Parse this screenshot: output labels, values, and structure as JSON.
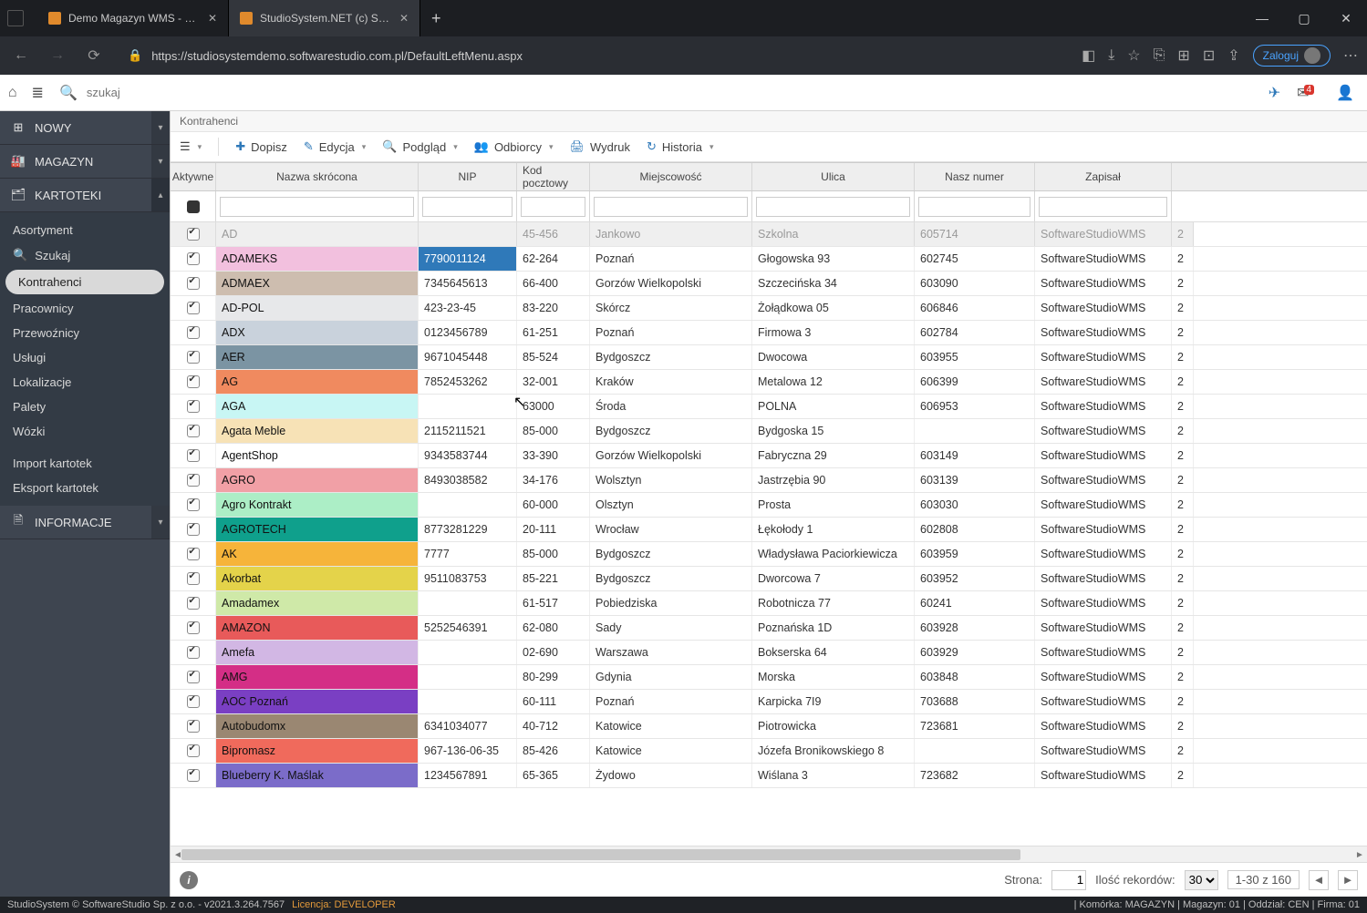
{
  "browser": {
    "tabs": [
      {
        "label": "Demo Magazyn WMS - Demo o…"
      },
      {
        "label": "StudioSystem.NET (c) SoftwareSt…"
      }
    ],
    "url": "https://studiosystemdemo.softwarestudio.com.pl/DefaultLeftMenu.aspx",
    "login": "Zaloguj"
  },
  "apptop": {
    "search_placeholder": "szukaj",
    "mail_badge": "4"
  },
  "sidebar": {
    "sections": {
      "nowy": "NOWY",
      "magazyn": "MAGAZYN",
      "kartoteki": "KARTOTEKI",
      "informacje": "INFORMACJE"
    },
    "kartoteki_sub": {
      "asortyment": "Asortyment",
      "szukaj": "Szukaj",
      "kontrahenci": "Kontrahenci",
      "pracownicy": "Pracownicy",
      "przewoznicy": "Przewoźnicy",
      "uslugi": "Usługi",
      "lokalizacje": "Lokalizacje",
      "palety": "Palety",
      "wozki": "Wózki",
      "import": "Import kartotek",
      "eksport": "Eksport kartotek"
    }
  },
  "crumb": "Kontrahenci",
  "toolbar": {
    "dopisz": "Dopisz",
    "edycja": "Edycja",
    "podglad": "Podgląd",
    "odbiorcy": "Odbiorcy",
    "wydruk": "Wydruk",
    "historia": "Historia"
  },
  "columns": {
    "aktywne": "Aktywne",
    "nazwa": "Nazwa skrócona",
    "nip": "NIP",
    "kod": "Kod pocztowy",
    "miejsc": "Miejscowość",
    "ulica": "Ulica",
    "naszn": "Nasz numer",
    "zapis": "Zapisał"
  },
  "rows": [
    {
      "partial": true,
      "chk": true,
      "name": "AD",
      "nip": "",
      "zip": "45-456",
      "city": "Jankowo",
      "street": "Szkolna",
      "num": "605714",
      "user": "SoftwareStudioWMS",
      "rest": "2",
      "bg": ""
    },
    {
      "chk": true,
      "name": "ADAMEKS",
      "nip": "7790011124",
      "zip": "62-264",
      "city": "Poznań",
      "street": "Głogowska 93",
      "num": "602745",
      "user": "SoftwareStudioWMS",
      "rest": "2",
      "bg": "#f2c0de",
      "sel": true
    },
    {
      "chk": true,
      "name": "ADMAEX",
      "nip": "7345645613",
      "zip": "66-400",
      "city": "Gorzów Wielkopolski",
      "street": "Szczecińska 34",
      "num": "603090",
      "user": "SoftwareStudioWMS",
      "rest": "2",
      "bg": "#cdbdaf"
    },
    {
      "chk": true,
      "name": "AD-POL",
      "nip": "423-23-45",
      "zip": "83-220",
      "city": "Skórcz",
      "street": "Żołądkowa 05",
      "num": "606846",
      "user": "SoftwareStudioWMS",
      "rest": "2",
      "bg": "#e7e8ea"
    },
    {
      "chk": true,
      "name": "ADX",
      "nip": "0123456789",
      "zip": "61-251",
      "city": "Poznań",
      "street": "Firmowa 3",
      "num": "602784",
      "user": "SoftwareStudioWMS",
      "rest": "2",
      "bg": "#c9d2dc"
    },
    {
      "chk": true,
      "name": "AER",
      "nip": "9671045448",
      "zip": "85-524",
      "city": "Bydgoszcz",
      "street": "Dwocowa",
      "num": "603955",
      "user": "SoftwareStudioWMS",
      "rest": "2",
      "bg": "#7b94a3"
    },
    {
      "chk": true,
      "name": "AG",
      "nip": "7852453262",
      "zip": "32-001",
      "city": "Kraków",
      "street": "Metalowa 12",
      "num": "606399",
      "user": "SoftwareStudioWMS",
      "rest": "2",
      "bg": "#f08a5f"
    },
    {
      "chk": true,
      "name": "AGA",
      "nip": "",
      "zip": "63000",
      "city": "Środa",
      "street": "POLNA",
      "num": "606953",
      "user": "SoftwareStudioWMS",
      "rest": "2",
      "bg": "#c8f6f4"
    },
    {
      "chk": true,
      "name": "Agata Meble",
      "nip": "2115211521",
      "zip": "85-000",
      "city": "Bydgoszcz",
      "street": "Bydgoska 15",
      "num": "",
      "user": "SoftwareStudioWMS",
      "rest": "2",
      "bg": "#f7e2b6"
    },
    {
      "chk": true,
      "name": "AgentShop",
      "nip": "9343583744",
      "zip": "33-390",
      "city": "Gorzów Wielkopolski",
      "street": "Fabryczna 29",
      "num": "603149",
      "user": "SoftwareStudioWMS",
      "rest": "2",
      "bg": "#ffffff"
    },
    {
      "chk": true,
      "name": "AGRO",
      "nip": "8493038582",
      "zip": "34-176",
      "city": "Wolsztyn",
      "street": "Jastrzębia 90",
      "num": "603139",
      "user": "SoftwareStudioWMS",
      "rest": "2",
      "bg": "#f1a0a6"
    },
    {
      "chk": true,
      "name": "Agro Kontrakt",
      "nip": "",
      "zip": "60-000",
      "city": "Olsztyn",
      "street": "Prosta",
      "num": "603030",
      "user": "SoftwareStudioWMS",
      "rest": "2",
      "bg": "#aceec6"
    },
    {
      "chk": true,
      "name": "AGROTECH",
      "nip": "8773281229",
      "zip": "20-111",
      "city": "Wrocław",
      "street": "Łękołody 1",
      "num": "602808",
      "user": "SoftwareStudioWMS",
      "rest": "2",
      "bg": "#0fa08c"
    },
    {
      "chk": true,
      "name": "AK",
      "nip": "7777",
      "zip": "85-000",
      "city": "Bydgoszcz",
      "street": "Władysława Paciorkiewicza",
      "num": "603959",
      "user": "SoftwareStudioWMS",
      "rest": "2",
      "bg": "#f6b43a"
    },
    {
      "chk": true,
      "name": "Akorbat",
      "nip": "9511083753",
      "zip": "85-221",
      "city": "Bydgoszcz",
      "street": "Dworcowa 7",
      "num": "603952",
      "user": "SoftwareStudioWMS",
      "rest": "2",
      "bg": "#e4d34a"
    },
    {
      "chk": true,
      "name": "Amadamex",
      "nip": "",
      "zip": "61-517",
      "city": "Pobiedziska",
      "street": "Robotnicza 77",
      "num": "60241",
      "user": "SoftwareStudioWMS",
      "rest": "2",
      "bg": "#cfe9a8"
    },
    {
      "chk": true,
      "name": "AMAZON",
      "nip": "5252546391",
      "zip": "62-080",
      "city": "Sady",
      "street": "Poznańska 1D",
      "num": "603928",
      "user": "SoftwareStudioWMS",
      "rest": "2",
      "bg": "#e85a5a"
    },
    {
      "chk": true,
      "name": "Amefa",
      "nip": "",
      "zip": "02-690",
      "city": "Warszawa",
      "street": "Bokserska 64",
      "num": "603929",
      "user": "SoftwareStudioWMS",
      "rest": "2",
      "bg": "#d2b7e4"
    },
    {
      "chk": true,
      "name": "AMG",
      "nip": "",
      "zip": "80-299",
      "city": "Gdynia",
      "street": "Morska",
      "num": "603848",
      "user": "SoftwareStudioWMS",
      "rest": "2",
      "bg": "#d42e86"
    },
    {
      "chk": true,
      "name": "AOC Poznań",
      "nip": "",
      "zip": "60-111",
      "city": "Poznań",
      "street": "Karpicka 7I9",
      "num": "703688",
      "user": "SoftwareStudioWMS",
      "rest": "2",
      "bg": "#7a3fc3"
    },
    {
      "chk": true,
      "name": "Autobudomx",
      "nip": "6341034077",
      "zip": "40-712",
      "city": "Katowice",
      "street": "Piotrowicka",
      "num": "723681",
      "user": "SoftwareStudioWMS",
      "rest": "2",
      "bg": "#9a8772"
    },
    {
      "chk": true,
      "name": "Bipromasz",
      "nip": "967-136-06-35",
      "zip": "85-426",
      "city": "Katowice",
      "street": "Józefa Bronikowskiego 8",
      "num": "",
      "user": "SoftwareStudioWMS",
      "rest": "2",
      "bg": "#f06a5c"
    },
    {
      "chk": true,
      "name": "Blueberry K. Maślak",
      "nip": "1234567891",
      "zip": "65-365",
      "city": "Żydowo",
      "street": "Wiślana 3",
      "num": "723682",
      "user": "SoftwareStudioWMS",
      "rest": "2",
      "bg": "#7b6cc9"
    }
  ],
  "pager": {
    "strona_label": "Strona:",
    "strona_val": "1",
    "ilosc_label": "Ilość rekordów:",
    "ilosc_val": "30",
    "range": "1-30 z 160"
  },
  "statusbar": {
    "left": "StudioSystem © SoftwareStudio Sp. z o.o. - v2021.3.264.7567",
    "lic": "Licencja: DEVELOPER",
    "right": "| Komórka: MAGAZYN | Magazyn: 01 | Oddział: CEN | Firma: 01"
  }
}
